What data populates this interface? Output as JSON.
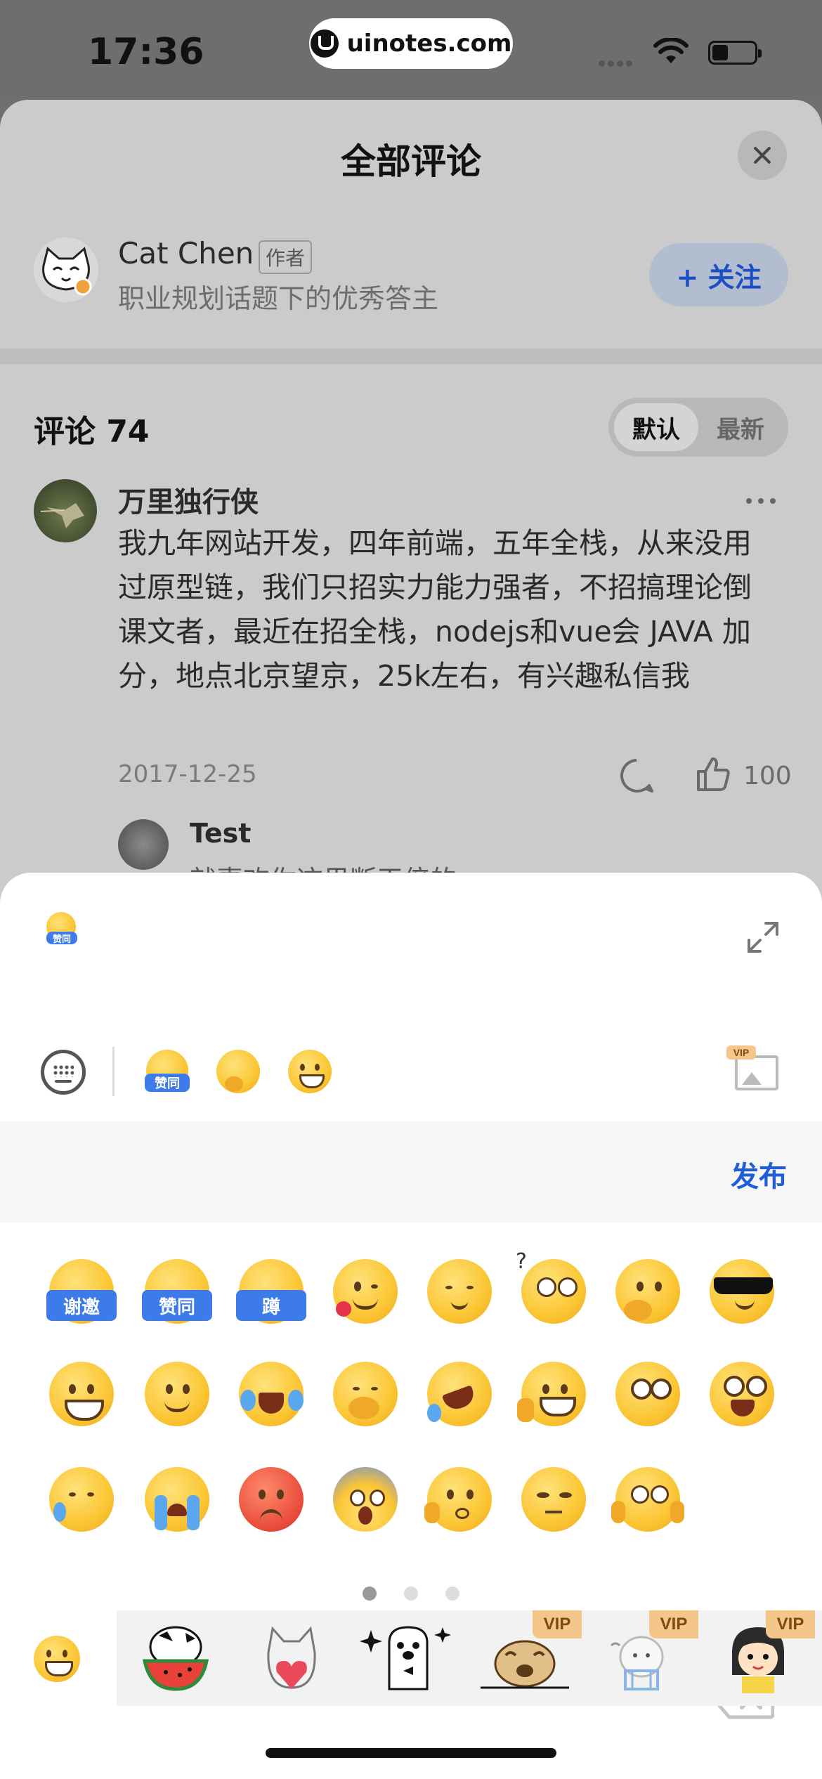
{
  "status_bar": {
    "time": "17:36",
    "url": "uinotes.com"
  },
  "sheet": {
    "title": "全部评论",
    "author": {
      "name": "Cat Chen",
      "tag": "作者",
      "description": "职业规划话题下的优秀答主",
      "follow_label": "+ 关注"
    },
    "comments_header": {
      "label": "评论 74",
      "sort_default": "默认",
      "sort_latest": "最新"
    },
    "comment": {
      "author": "万里独行侠",
      "text": "我九年网站开发，四年前端，五年全栈，从来没用过原型链，我们只招实力能力强者，不招搞理论倒课文者，最近在招全栈，nodejs和vue会 JAVA 加分，地点北京望京，25k左右，有兴趣私信我",
      "date": "2017-12-25",
      "likes": "100"
    },
    "reply": {
      "author": "Test",
      "text": "就喜欢你这果断干倍的"
    }
  },
  "composer": {
    "draft_sticker_label": "赞同",
    "recent_stickers": [
      "赞同",
      "thinking",
      "grin"
    ],
    "vip_label": "VIP",
    "publish_label": "发布",
    "emoji_rows": [
      [
        "谢邀",
        "赞同",
        "蹲",
        "wink-heart",
        "content",
        "question",
        "thinking",
        "cool"
      ],
      [
        "grin",
        "smile",
        "laugh-cry",
        "hide-laugh",
        "roll-laugh",
        "victory",
        "shy",
        "surprised-happy"
      ],
      [
        "tear",
        "cry",
        "angry",
        "scream",
        "pout",
        "tired",
        "blank",
        "backspace"
      ]
    ],
    "page_count": 3,
    "current_page": 1,
    "sticker_tabs": [
      "emoji",
      "watermelon-cow",
      "cat-heart",
      "sparkle-dog",
      "pug",
      "bunny",
      "girl"
    ],
    "vip_tabs": [
      4,
      5,
      6
    ]
  }
}
